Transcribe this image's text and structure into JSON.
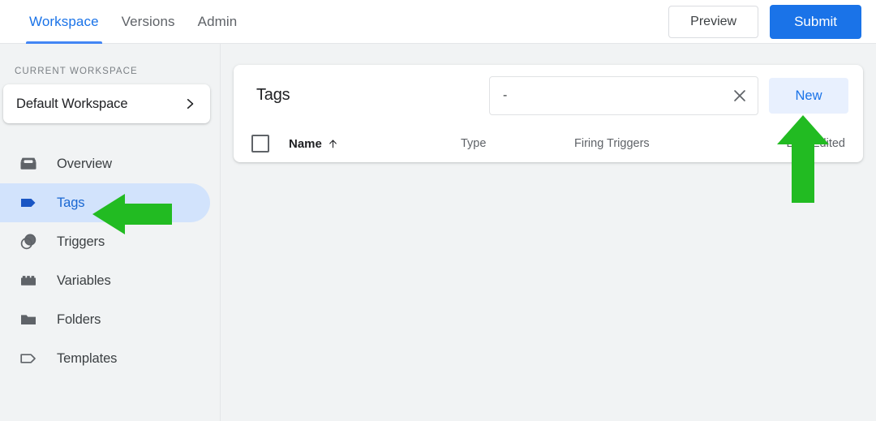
{
  "header": {
    "tabs": [
      {
        "label": "Workspace",
        "active": true
      },
      {
        "label": "Versions",
        "active": false
      },
      {
        "label": "Admin",
        "active": false
      }
    ],
    "preview_label": "Preview",
    "submit_label": "Submit",
    "accent_color": "#1a73e8",
    "active_tab_underline_color": "#4285f4"
  },
  "sidebar": {
    "section_label": "CURRENT WORKSPACE",
    "workspace": {
      "name": "Default Workspace",
      "chevron_icon": "chevron-right-icon"
    },
    "items": [
      {
        "label": "Overview",
        "icon": "overview-box-icon",
        "active": false
      },
      {
        "label": "Tags",
        "icon": "tag-filled-icon",
        "active": true
      },
      {
        "label": "Triggers",
        "icon": "overlapping-circles-icon",
        "active": false
      },
      {
        "label": "Variables",
        "icon": "variables-brick-icon",
        "active": false
      },
      {
        "label": "Folders",
        "icon": "folder-icon",
        "active": false
      },
      {
        "label": "Templates",
        "icon": "tag-outline-icon",
        "active": false
      }
    ],
    "active_background": "#d2e3fc",
    "active_text_color": "#1967d2",
    "background": "#f1f3f4"
  },
  "main": {
    "card": {
      "title": "Tags",
      "search": {
        "value": "-",
        "placeholder": "",
        "clear_icon": "close-x-icon"
      },
      "new_button_label": "New",
      "table": {
        "select_all_checkbox": false,
        "columns": [
          {
            "label": "Name",
            "sort_icon": "arrow-up-icon",
            "sorted": true
          },
          {
            "label": "Type",
            "sorted": false
          },
          {
            "label": "Firing Triggers",
            "sorted": false
          },
          {
            "label": "Last Edited",
            "sorted": false
          }
        ],
        "rows": []
      }
    }
  },
  "annotations": [
    {
      "name": "arrow-pointing-at-tags",
      "direction": "left",
      "color": "#22bb22"
    },
    {
      "name": "arrow-pointing-at-new-button",
      "direction": "up",
      "color": "#22bb22"
    }
  ]
}
